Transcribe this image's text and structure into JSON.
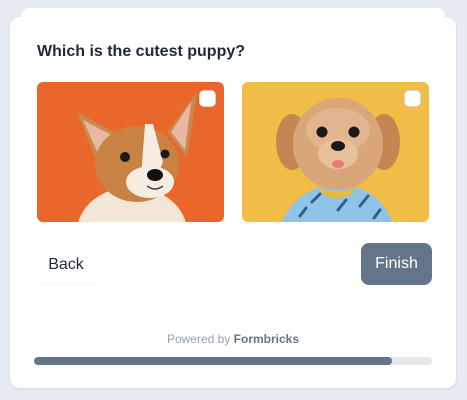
{
  "survey": {
    "question": "Which is the cutest puppy?",
    "choices": [
      {
        "image": "corgi-puppy-photo",
        "selected": false
      },
      {
        "image": "fluffy-puppy-in-shirt-photo",
        "selected": false
      }
    ],
    "back_label": "Back",
    "finish_label": "Finish",
    "powered_prefix": "Powered by",
    "powered_brand": "Formbricks",
    "progress": 0.9
  },
  "colors": {
    "accent": "#64748b",
    "background": "#e6ebf1",
    "left_image_bg": "#ea6a2e",
    "right_image_bg": "#f0bd46"
  }
}
